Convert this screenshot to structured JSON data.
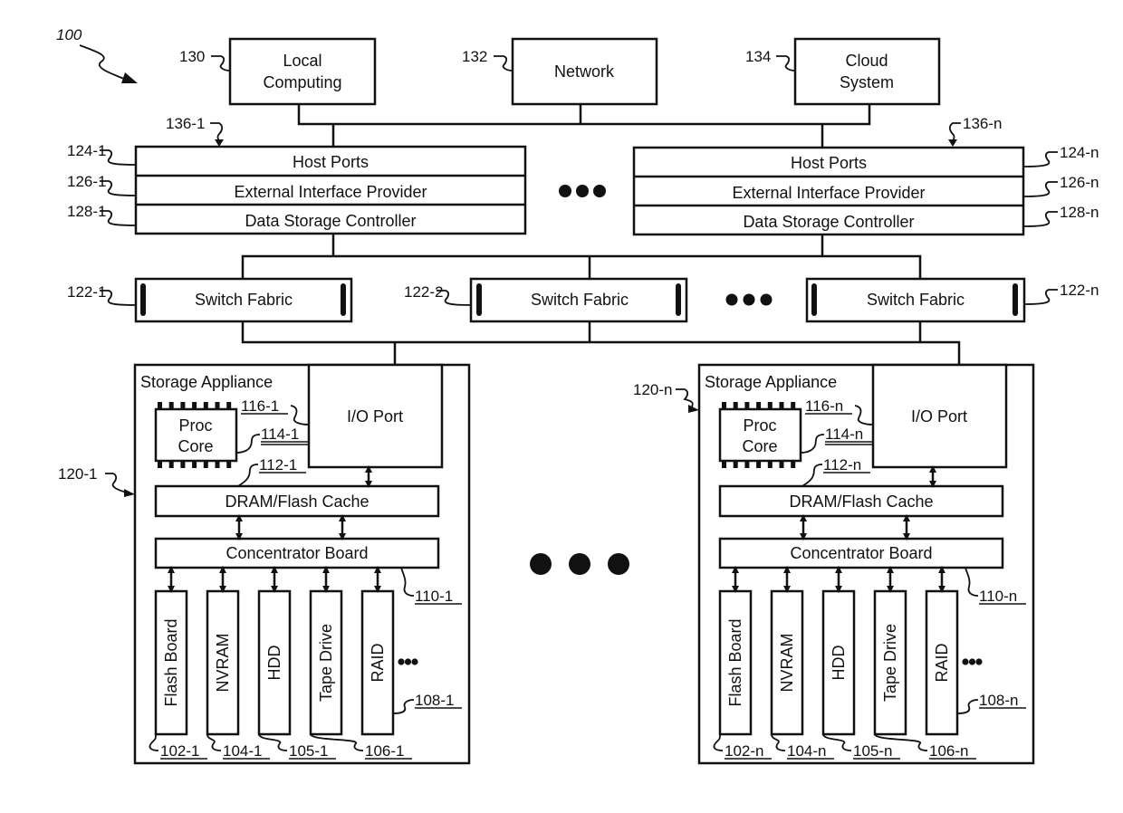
{
  "figure": {
    "ref": "100",
    "top_nodes": [
      {
        "ref": "130",
        "lines": [
          "Local",
          "Computing"
        ]
      },
      {
        "ref": "132",
        "lines": [
          "Network"
        ]
      },
      {
        "ref": "134",
        "lines": [
          "Cloud",
          "System"
        ]
      }
    ],
    "controllers": [
      {
        "ref": "136-1",
        "host_ports": "Host Ports",
        "host_ports_ref": "124-1",
        "eip": "External Interface Provider",
        "eip_ref": "126-1",
        "dsc": "Data Storage Controller",
        "dsc_ref": "128-1"
      },
      {
        "ref": "136-n",
        "host_ports": "Host Ports",
        "host_ports_ref": "124-n",
        "eip": "External Interface Provider",
        "eip_ref": "126-n",
        "dsc": "Data Storage Controller",
        "dsc_ref": "128-n"
      }
    ],
    "switch_fabrics": [
      {
        "ref": "122-1",
        "label": "Switch Fabric"
      },
      {
        "ref": "122-2",
        "label": "Switch Fabric"
      },
      {
        "ref": "122-n",
        "label": "Switch Fabric"
      }
    ],
    "appliances": [
      {
        "ref": "120-1",
        "title": "Storage Appliance",
        "io_port": "I/O Port",
        "io_port_ref": "116-1",
        "proc": [
          "Proc",
          "Core"
        ],
        "proc_ref": "114-1",
        "cache": "DRAM/Flash Cache",
        "cache_ref": "112-1",
        "concentrator": "Concentrator Board",
        "concentrator_ref": "110-1",
        "devices": [
          {
            "label": "Flash Board",
            "ref": "102-1"
          },
          {
            "label": "NVRAM",
            "ref": "104-1"
          },
          {
            "label": "HDD",
            "ref": "105-1"
          },
          {
            "label": "Tape Drive",
            "ref": "106-1"
          },
          {
            "label": "RAID",
            "ref": "108-1"
          }
        ]
      },
      {
        "ref": "120-n",
        "title": "Storage Appliance",
        "io_port": "I/O Port",
        "io_port_ref": "116-n",
        "proc": [
          "Proc",
          "Core"
        ],
        "proc_ref": "114-n",
        "cache": "DRAM/Flash Cache",
        "cache_ref": "112-n",
        "concentrator": "Concentrator Board",
        "concentrator_ref": "110-n",
        "devices": [
          {
            "label": "Flash Board",
            "ref": "102-n"
          },
          {
            "label": "NVRAM",
            "ref": "104-n"
          },
          {
            "label": "HDD",
            "ref": "105-n"
          },
          {
            "label": "Tape Drive",
            "ref": "106-n"
          },
          {
            "label": "RAID",
            "ref": "108-n"
          }
        ]
      }
    ]
  }
}
